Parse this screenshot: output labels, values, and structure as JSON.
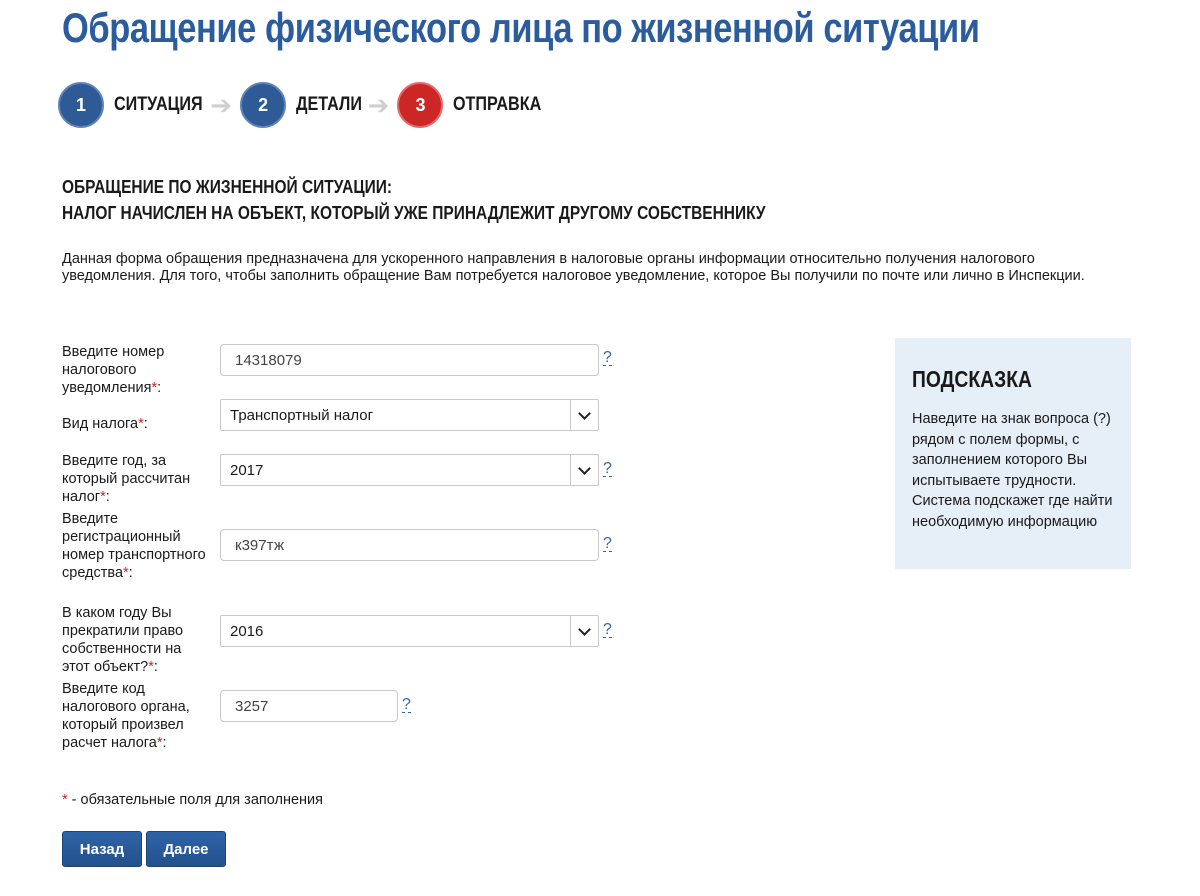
{
  "page": {
    "title": "Обращение физического лица по жизненной ситуации"
  },
  "steps": [
    {
      "number": "1",
      "label": "СИТУАЦИЯ",
      "state": "done"
    },
    {
      "number": "2",
      "label": "ДЕТАЛИ",
      "state": "done"
    },
    {
      "number": "3",
      "label": "ОТПРАВКА",
      "state": "current"
    }
  ],
  "section": {
    "heading_line1": "ОБРАЩЕНИЕ ПО ЖИЗНЕННОЙ СИТУАЦИИ:",
    "heading_line2": "НАЛОГ НАЧИСЛЕН НА ОБЪЕКТ, КОТОРЫЙ УЖЕ ПРИНАДЛЕЖИТ ДРУГОМУ СОБСТВЕННИКУ",
    "intro": "Данная форма обращения предназначена для ускоренного направления в налоговые органы информации относительно получения налогового уведомления. Для того, чтобы заполнить обращение Вам потребуется налоговое уведомление, которое Вы получили по почте или лично в Инспекции."
  },
  "form": {
    "required_mark": "*",
    "help_mark": "?",
    "fields": [
      {
        "label": "Введите номер налогового уведомления",
        "type": "input",
        "value": "14318079"
      },
      {
        "label": "Вид налога",
        "type": "select",
        "value": "Транспортный налог"
      },
      {
        "label": "Введите год, за который рассчитан налог",
        "type": "select",
        "value": "2017"
      },
      {
        "label": "Введите регистрационный номер транспортного средства",
        "type": "input",
        "value": "к397тж"
      },
      {
        "label": "В каком году Вы прекратили право собственности на этот объект?",
        "type": "select",
        "value": "2016"
      },
      {
        "label": "Введите код налогового органа, который произвел расчет налога",
        "type": "input",
        "value": "3257"
      }
    ]
  },
  "hint": {
    "title": "ПОДСКАЗКА",
    "text": "Наведите на знак вопроса (?) рядом с полем формы, с заполнением которого Вы испытываете трудности. Система подскажет где найти необходимую информацию"
  },
  "footer": {
    "required_note": " - обязательные поля для заполнения"
  },
  "buttons": {
    "back": "Назад",
    "next": "Далее"
  },
  "colors": {
    "title_blue": "#2a5c9e",
    "step_blue": "#2e5a96",
    "step_active_red": "#cc2626",
    "hint_bg": "#e6eef8",
    "button_blue": "#2a5a9b",
    "required_red": "#d11f1f"
  }
}
